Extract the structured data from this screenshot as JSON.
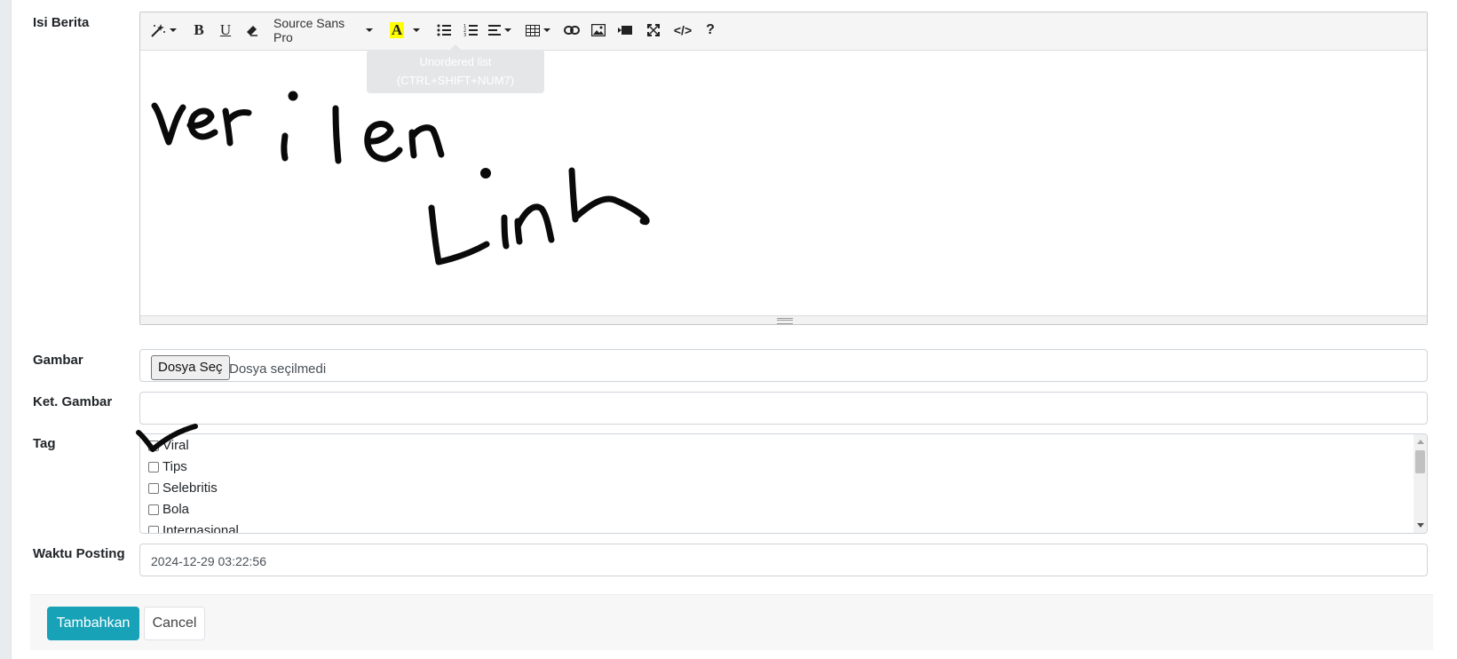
{
  "form": {
    "content_label": "Isi Berita",
    "image_label": "Gambar",
    "caption_label": "Ket. Gambar",
    "tag_label": "Tag",
    "time_label": "Waktu Posting"
  },
  "editor": {
    "font_name": "Source Sans Pro",
    "highlight_letter": "A",
    "help_glyph": "?",
    "code_glyph": "</>",
    "tooltip_line1": "Unordered list",
    "tooltip_line2": "(CTRL+SHIFT+NUM7)",
    "handwriting": [
      "ver i len",
      "Link"
    ]
  },
  "file_input": {
    "button_label": "Dosya Seç",
    "status_text": "Dosya seçilmedi"
  },
  "caption_input": {
    "value": ""
  },
  "tags": [
    "Viral",
    "Tips",
    "Selebritis",
    "Bola",
    "Internasional"
  ],
  "posting_time": "2024-12-29 03:22:56",
  "actions": {
    "submit_label": "Tambahkan",
    "cancel_label": "Cancel"
  },
  "colors": {
    "primary": "#17a2b8",
    "highlight": "#ffff00"
  }
}
